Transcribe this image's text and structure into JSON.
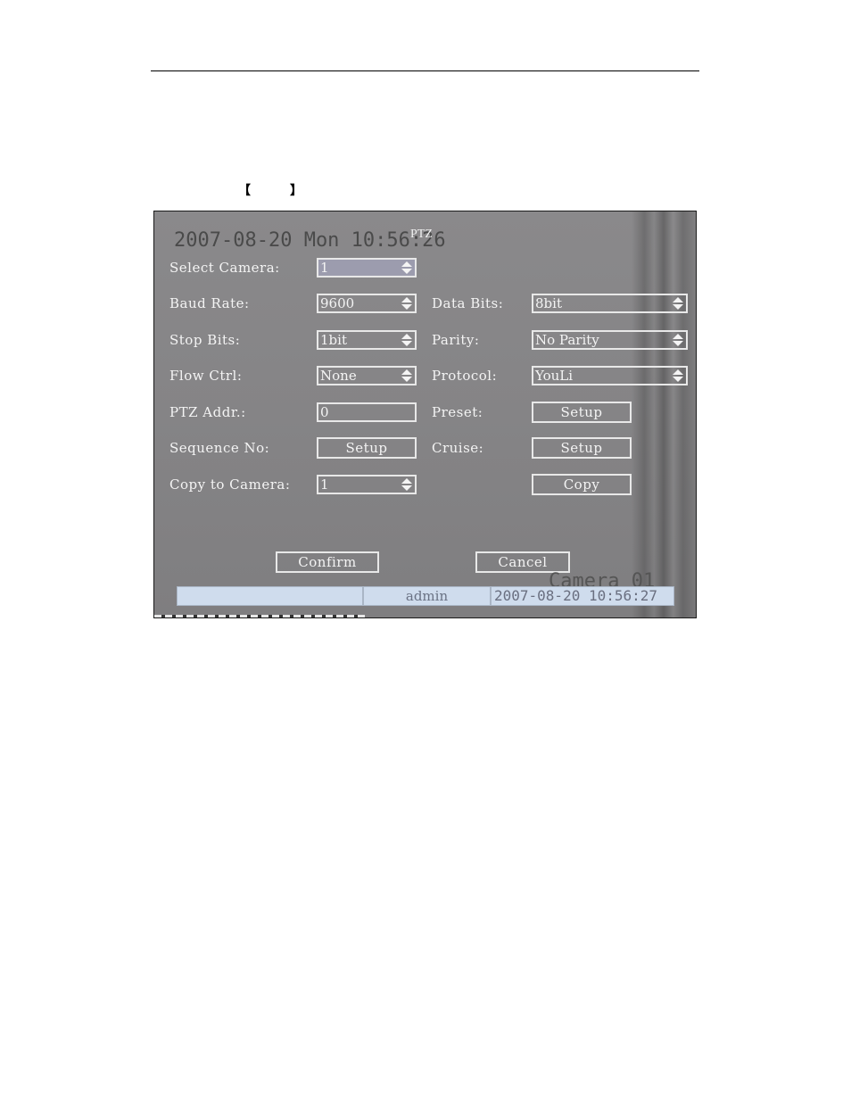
{
  "document": {
    "bracket_left": "【",
    "bracket_right": "】"
  },
  "osd": {
    "datetime": "2007-08-20 Mon 10:56:26",
    "camera_label": "Camera 01"
  },
  "dialog": {
    "title": "PTZ",
    "select_camera": {
      "label": "Select Camera:",
      "value": "1"
    },
    "baud_rate": {
      "label": "Baud Rate:",
      "value": "9600"
    },
    "data_bits": {
      "label": "Data Bits:",
      "value": "8bit"
    },
    "stop_bits": {
      "label": "Stop Bits:",
      "value": "1bit"
    },
    "parity": {
      "label": "Parity:",
      "value": "No Parity"
    },
    "flow_ctrl": {
      "label": "Flow Ctrl:",
      "value": "None"
    },
    "protocol": {
      "label": "Protocol:",
      "value": "YouLi"
    },
    "ptz_addr": {
      "label": "PTZ Addr.:",
      "value": "0"
    },
    "preset": {
      "label": "Preset:",
      "button": "Setup"
    },
    "sequence_no": {
      "label": "Sequence No:",
      "button": "Setup"
    },
    "cruise": {
      "label": "Cruise:",
      "button": "Setup"
    },
    "copy_to_camera": {
      "label": "Copy to Camera:",
      "value": "1"
    },
    "copy_button": "Copy",
    "confirm_button": "Confirm",
    "cancel_button": "Cancel"
  },
  "statusbar": {
    "blank": "",
    "user": "admin",
    "time": "2007-08-20 10:56:27"
  }
}
